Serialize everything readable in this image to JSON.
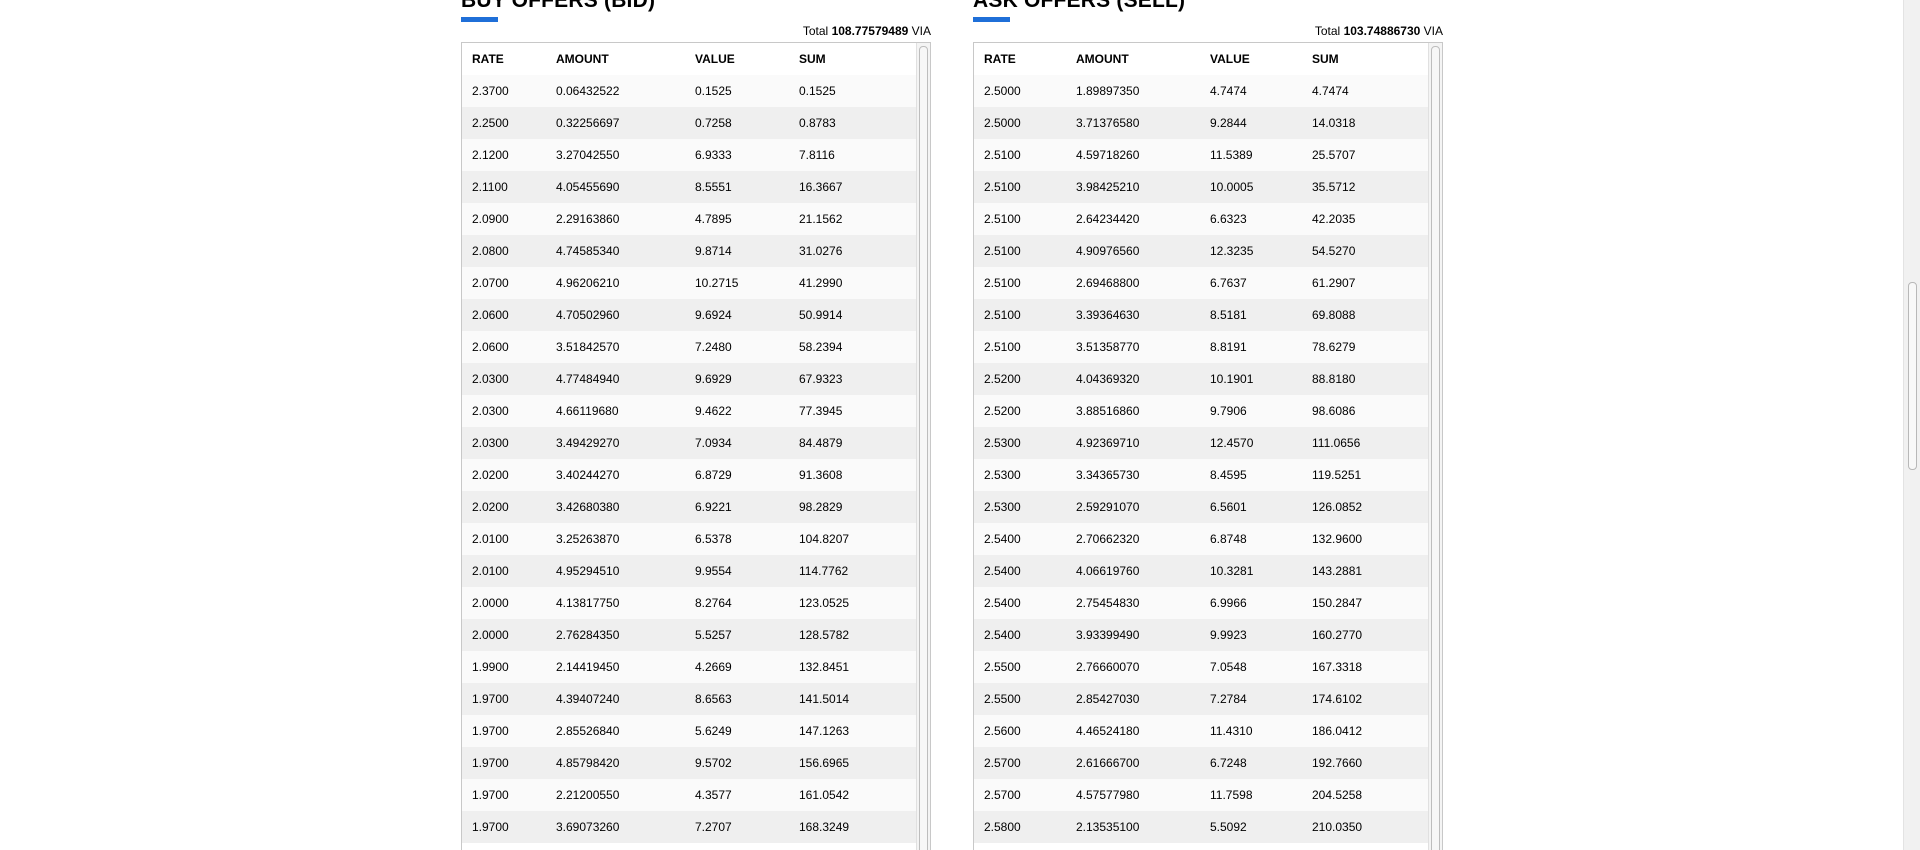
{
  "bid": {
    "title": "BUY OFFERS (BID)",
    "total_label": "Total",
    "total_value": "108.77579489",
    "total_unit": "VIA",
    "columns": [
      "RATE",
      "AMOUNT",
      "VALUE",
      "SUM"
    ],
    "rows": [
      [
        "2.3700",
        "0.06432522",
        "0.1525",
        "0.1525"
      ],
      [
        "2.2500",
        "0.32256697",
        "0.7258",
        "0.8783"
      ],
      [
        "2.1200",
        "3.27042550",
        "6.9333",
        "7.8116"
      ],
      [
        "2.1100",
        "4.05455690",
        "8.5551",
        "16.3667"
      ],
      [
        "2.0900",
        "2.29163860",
        "4.7895",
        "21.1562"
      ],
      [
        "2.0800",
        "4.74585340",
        "9.8714",
        "31.0276"
      ],
      [
        "2.0700",
        "4.96206210",
        "10.2715",
        "41.2990"
      ],
      [
        "2.0600",
        "4.70502960",
        "9.6924",
        "50.9914"
      ],
      [
        "2.0600",
        "3.51842570",
        "7.2480",
        "58.2394"
      ],
      [
        "2.0300",
        "4.77484940",
        "9.6929",
        "67.9323"
      ],
      [
        "2.0300",
        "4.66119680",
        "9.4622",
        "77.3945"
      ],
      [
        "2.0300",
        "3.49429270",
        "7.0934",
        "84.4879"
      ],
      [
        "2.0200",
        "3.40244270",
        "6.8729",
        "91.3608"
      ],
      [
        "2.0200",
        "3.42680380",
        "6.9221",
        "98.2829"
      ],
      [
        "2.0100",
        "3.25263870",
        "6.5378",
        "104.8207"
      ],
      [
        "2.0100",
        "4.95294510",
        "9.9554",
        "114.7762"
      ],
      [
        "2.0000",
        "4.13817750",
        "8.2764",
        "123.0525"
      ],
      [
        "2.0000",
        "2.76284350",
        "5.5257",
        "128.5782"
      ],
      [
        "1.9900",
        "2.14419450",
        "4.2669",
        "132.8451"
      ],
      [
        "1.9700",
        "4.39407240",
        "8.6563",
        "141.5014"
      ],
      [
        "1.9700",
        "2.85526840",
        "5.6249",
        "147.1263"
      ],
      [
        "1.9700",
        "4.85798420",
        "9.5702",
        "156.6965"
      ],
      [
        "1.9700",
        "2.21200550",
        "4.3577",
        "161.0542"
      ],
      [
        "1.9700",
        "3.69073260",
        "7.2707",
        "168.3249"
      ]
    ]
  },
  "ask": {
    "title": "ASK OFFERS (SELL)",
    "total_label": "Total",
    "total_value": "103.74886730",
    "total_unit": "VIA",
    "columns": [
      "RATE",
      "AMOUNT",
      "VALUE",
      "SUM"
    ],
    "rows": [
      [
        "2.5000",
        "1.89897350",
        "4.7474",
        "4.7474"
      ],
      [
        "2.5000",
        "3.71376580",
        "9.2844",
        "14.0318"
      ],
      [
        "2.5100",
        "4.59718260",
        "11.5389",
        "25.5707"
      ],
      [
        "2.5100",
        "3.98425210",
        "10.0005",
        "35.5712"
      ],
      [
        "2.5100",
        "2.64234420",
        "6.6323",
        "42.2035"
      ],
      [
        "2.5100",
        "4.90976560",
        "12.3235",
        "54.5270"
      ],
      [
        "2.5100",
        "2.69468800",
        "6.7637",
        "61.2907"
      ],
      [
        "2.5100",
        "3.39364630",
        "8.5181",
        "69.8088"
      ],
      [
        "2.5100",
        "3.51358770",
        "8.8191",
        "78.6279"
      ],
      [
        "2.5200",
        "4.04369320",
        "10.1901",
        "88.8180"
      ],
      [
        "2.5200",
        "3.88516860",
        "9.7906",
        "98.6086"
      ],
      [
        "2.5300",
        "4.92369710",
        "12.4570",
        "111.0656"
      ],
      [
        "2.5300",
        "3.34365730",
        "8.4595",
        "119.5251"
      ],
      [
        "2.5300",
        "2.59291070",
        "6.5601",
        "126.0852"
      ],
      [
        "2.5400",
        "2.70662320",
        "6.8748",
        "132.9600"
      ],
      [
        "2.5400",
        "4.06619760",
        "10.3281",
        "143.2881"
      ],
      [
        "2.5400",
        "2.75454830",
        "6.9966",
        "150.2847"
      ],
      [
        "2.5400",
        "3.93399490",
        "9.9923",
        "160.2770"
      ],
      [
        "2.5500",
        "2.76660070",
        "7.0548",
        "167.3318"
      ],
      [
        "2.5500",
        "2.85427030",
        "7.2784",
        "174.6102"
      ],
      [
        "2.5600",
        "4.46524180",
        "11.4310",
        "186.0412"
      ],
      [
        "2.5700",
        "2.61666700",
        "6.7248",
        "192.7660"
      ],
      [
        "2.5700",
        "4.57577980",
        "11.7598",
        "204.5258"
      ],
      [
        "2.5800",
        "2.13535100",
        "5.5092",
        "210.0350"
      ]
    ]
  },
  "theme": {
    "accent": "#1f6fd8",
    "row_odd": "#fafafa",
    "row_even": "#efefef",
    "border": "#c8c8c8"
  }
}
